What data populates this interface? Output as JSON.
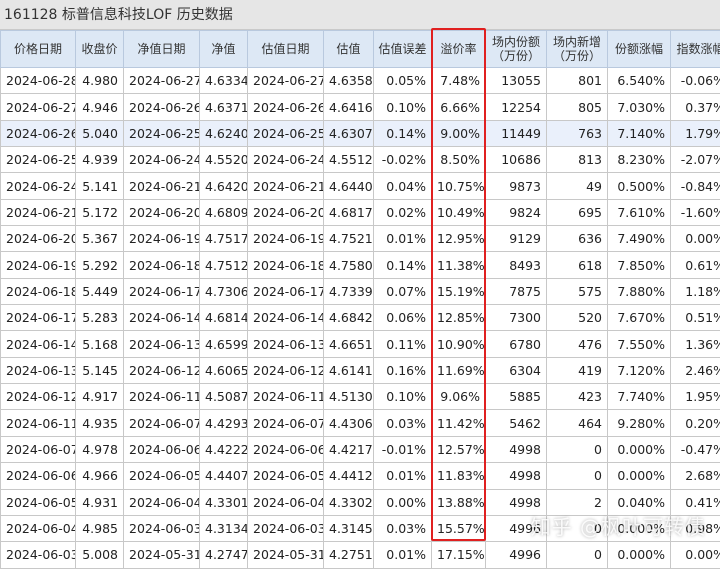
{
  "title": "161128 标普信息科技LOF 历史数据",
  "headers": [
    "价格日期",
    "收盘价",
    "净值日期",
    "净值",
    "估值日期",
    "估值",
    "估值误差",
    "溢价率",
    "场内份额\n（万份）",
    "场内新增\n（万份）",
    "份额涨幅",
    "指数涨幅"
  ],
  "highlight_row_index": 2,
  "rows": [
    [
      "2024-06-28",
      "4.980",
      "2024-06-27",
      "4.6334",
      "2024-06-27",
      "4.6358",
      "0.05%",
      "7.48%",
      "13055",
      "801",
      "6.540%",
      "-0.06%"
    ],
    [
      "2024-06-27",
      "4.946",
      "2024-06-26",
      "4.6371",
      "2024-06-26",
      "4.6416",
      "0.10%",
      "6.66%",
      "12254",
      "805",
      "7.030%",
      "0.37%"
    ],
    [
      "2024-06-26",
      "5.040",
      "2024-06-25",
      "4.6240",
      "2024-06-25",
      "4.6307",
      "0.14%",
      "9.00%",
      "11449",
      "763",
      "7.140%",
      "1.79%"
    ],
    [
      "2024-06-25",
      "4.939",
      "2024-06-24",
      "4.5520",
      "2024-06-24",
      "4.5512",
      "-0.02%",
      "8.50%",
      "10686",
      "813",
      "8.230%",
      "-2.07%"
    ],
    [
      "2024-06-24",
      "5.141",
      "2024-06-21",
      "4.6420",
      "2024-06-21",
      "4.6440",
      "0.04%",
      "10.75%",
      "9873",
      "49",
      "0.500%",
      "-0.84%"
    ],
    [
      "2024-06-21",
      "5.172",
      "2024-06-20",
      "4.6809",
      "2024-06-20",
      "4.6817",
      "0.02%",
      "10.49%",
      "9824",
      "695",
      "7.610%",
      "-1.60%"
    ],
    [
      "2024-06-20",
      "5.367",
      "2024-06-19",
      "4.7517",
      "2024-06-19",
      "4.7521",
      "0.01%",
      "12.95%",
      "9129",
      "636",
      "7.490%",
      "0.00%"
    ],
    [
      "2024-06-19",
      "5.292",
      "2024-06-18",
      "4.7512",
      "2024-06-18",
      "4.7580",
      "0.14%",
      "11.38%",
      "8493",
      "618",
      "7.850%",
      "0.61%"
    ],
    [
      "2024-06-18",
      "5.449",
      "2024-06-17",
      "4.7306",
      "2024-06-17",
      "4.7339",
      "0.07%",
      "15.19%",
      "7875",
      "575",
      "7.880%",
      "1.18%"
    ],
    [
      "2024-06-17",
      "5.283",
      "2024-06-14",
      "4.6814",
      "2024-06-14",
      "4.6842",
      "0.06%",
      "12.85%",
      "7300",
      "520",
      "7.670%",
      "0.51%"
    ],
    [
      "2024-06-14",
      "5.168",
      "2024-06-13",
      "4.6599",
      "2024-06-13",
      "4.6651",
      "0.11%",
      "10.90%",
      "6780",
      "476",
      "7.550%",
      "1.36%"
    ],
    [
      "2024-06-13",
      "5.145",
      "2024-06-12",
      "4.6065",
      "2024-06-12",
      "4.6141",
      "0.16%",
      "11.69%",
      "6304",
      "419",
      "7.120%",
      "2.46%"
    ],
    [
      "2024-06-12",
      "4.917",
      "2024-06-11",
      "4.5087",
      "2024-06-11",
      "4.5130",
      "0.10%",
      "9.06%",
      "5885",
      "423",
      "7.740%",
      "1.95%"
    ],
    [
      "2024-06-11",
      "4.935",
      "2024-06-07",
      "4.4293",
      "2024-06-07",
      "4.4306",
      "0.03%",
      "11.42%",
      "5462",
      "464",
      "9.280%",
      "0.20%"
    ],
    [
      "2024-06-07",
      "4.978",
      "2024-06-06",
      "4.4222",
      "2024-06-06",
      "4.4217",
      "-0.01%",
      "12.57%",
      "4998",
      "0",
      "0.000%",
      "-0.47%"
    ],
    [
      "2024-06-06",
      "4.966",
      "2024-06-05",
      "4.4407",
      "2024-06-05",
      "4.4412",
      "0.01%",
      "11.83%",
      "4998",
      "0",
      "0.000%",
      "2.68%"
    ],
    [
      "2024-06-05",
      "4.931",
      "2024-06-04",
      "4.3301",
      "2024-06-04",
      "4.3302",
      "0.00%",
      "13.88%",
      "4998",
      "2",
      "0.040%",
      "0.41%"
    ],
    [
      "2024-06-04",
      "4.985",
      "2024-06-03",
      "4.3134",
      "2024-06-03",
      "4.3145",
      "0.03%",
      "15.57%",
      "4996",
      "0",
      "0.000%",
      "0.98%"
    ],
    [
      "2024-06-03",
      "5.008",
      "2024-05-31",
      "4.2747",
      "2024-05-31",
      "4.2751",
      "0.01%",
      "17.15%",
      "4996",
      "0",
      "0.000%",
      "0.00%"
    ]
  ],
  "watermark": "知乎 @枫叶可转债",
  "colors": {
    "header_bg": "#dde8f5",
    "highlight_row_bg": "#eaf0fb",
    "box_red": "#e02020"
  }
}
